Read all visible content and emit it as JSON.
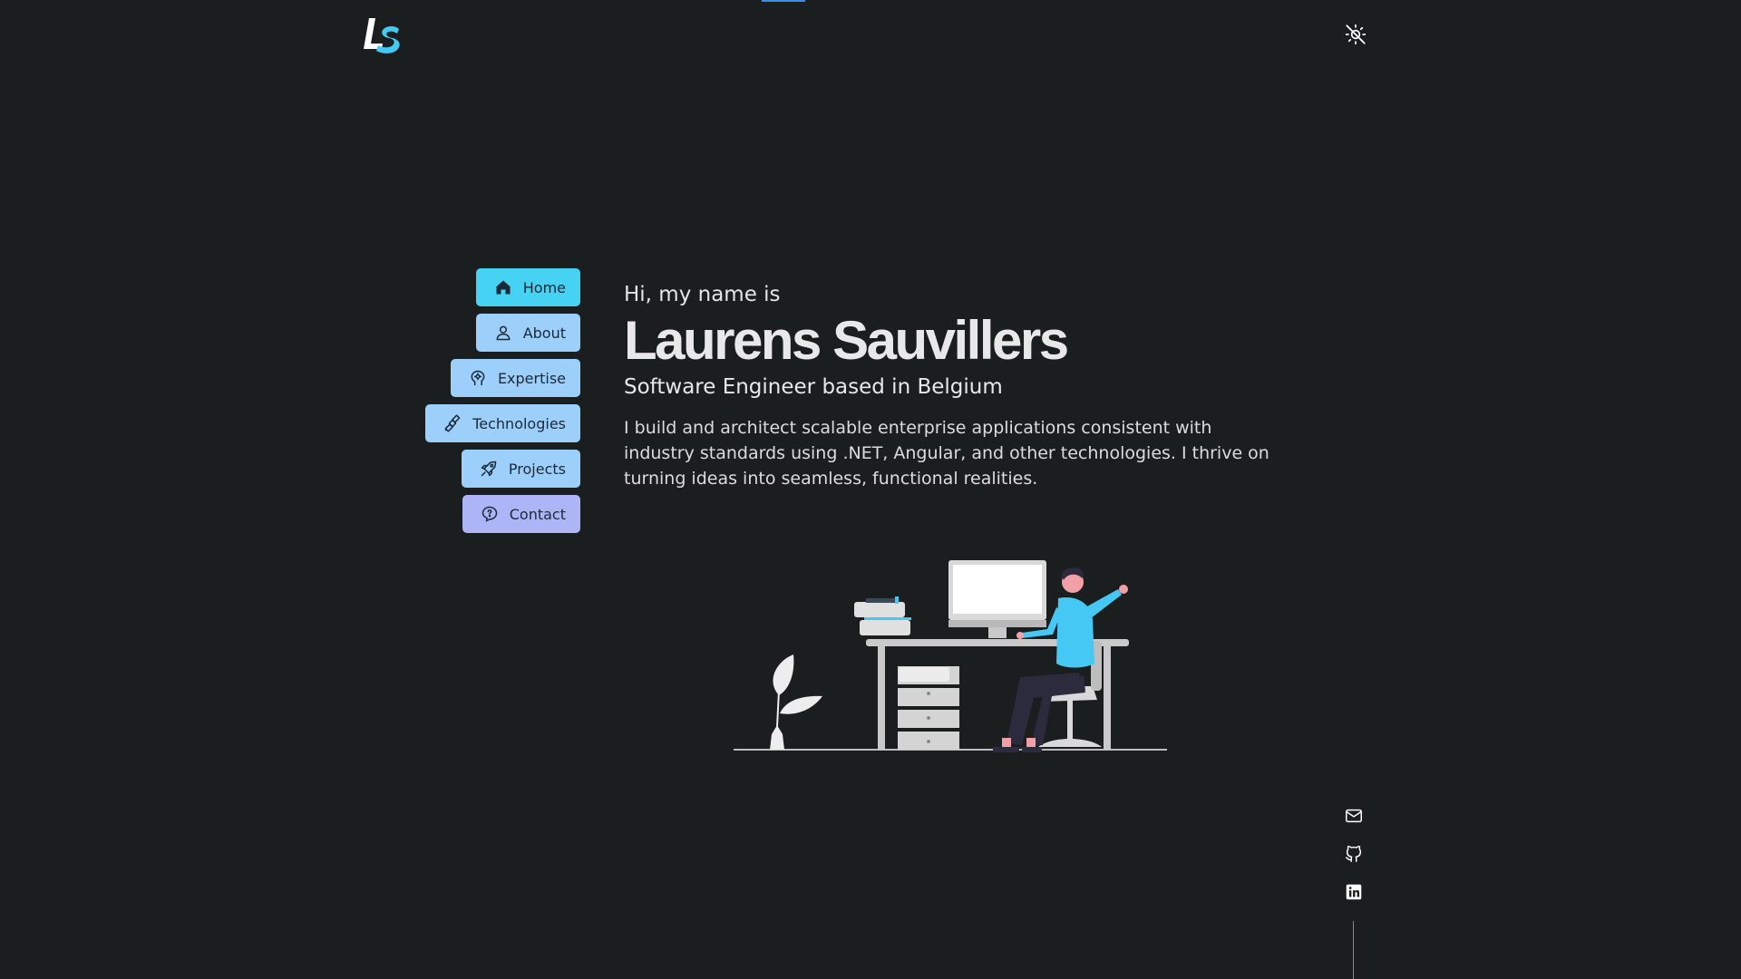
{
  "logo": {
    "icon": "ls-logo",
    "colors": [
      "#ffffff",
      "#45c8f3"
    ]
  },
  "header": {
    "theme_toggle_icon": "sun-off-icon"
  },
  "nav": {
    "items": [
      {
        "label": "Home",
        "icon": "home-icon",
        "active": true
      },
      {
        "label": "About",
        "icon": "user-icon",
        "active": false
      },
      {
        "label": "Expertise",
        "icon": "brain-icon",
        "active": false
      },
      {
        "label": "Technologies",
        "icon": "satellite-icon",
        "active": false
      },
      {
        "label": "Projects",
        "icon": "rocket-icon",
        "active": false
      },
      {
        "label": "Contact",
        "icon": "chat-question-icon",
        "active": false
      }
    ]
  },
  "hero": {
    "greeting": "Hi, my name is",
    "name": "Laurens Sauvillers",
    "subtitle": "Software Engineer based in Belgium",
    "bio": "I build and architect scalable enterprise applications consistent with industry standards using .NET, Angular, and other technologies. I thrive on turning ideas into seamless, functional realities."
  },
  "social": {
    "items": [
      {
        "icon": "mail-icon"
      },
      {
        "icon": "github-icon"
      },
      {
        "icon": "linkedin-icon"
      }
    ]
  },
  "colors": {
    "background": "#1b1e1f",
    "accent": "#45d2f3",
    "nav_default": "#9ccff9",
    "nav_contact": "#aeb5f6"
  }
}
